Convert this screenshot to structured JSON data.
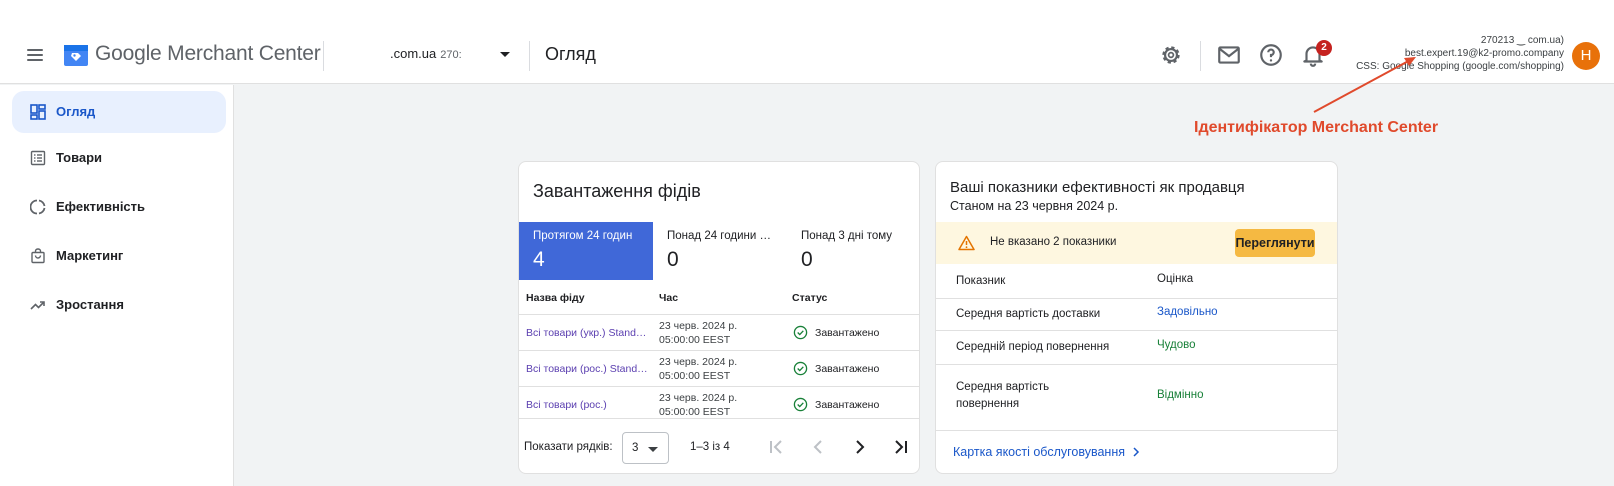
{
  "app": {
    "title": "Google Merchant Center",
    "account_name": ".com.ua",
    "account_id": "270:",
    "page_title": "Огляд",
    "notification_count": "2",
    "account_info": {
      "line1": "270213          ‿      com.ua)",
      "line2": "best.expert.19@k2-promo.company",
      "line3": "CSS: Google Shopping (google.com/shopping)"
    },
    "avatar_letter": "H"
  },
  "annotation": "Ідентифікатор Merchant Center",
  "sidebar": {
    "items": [
      {
        "label": "Огляд",
        "icon": "dashboard-icon",
        "active": true
      },
      {
        "label": "Товари",
        "icon": "list-alt-icon",
        "active": false
      },
      {
        "label": "Ефективність",
        "icon": "donut-icon",
        "active": false
      },
      {
        "label": "Маркетинг",
        "icon": "shopping-bag-icon",
        "active": false
      },
      {
        "label": "Зростання",
        "icon": "trending-up-icon",
        "active": false
      }
    ]
  },
  "feeds_card": {
    "title": "Завантаження фідів",
    "tabs": [
      {
        "label": "Протягом 24 годин",
        "value": "4",
        "selected": true
      },
      {
        "label": "Понад 24 години …",
        "value": "0",
        "selected": false
      },
      {
        "label": "Понад 3 дні тому",
        "value": "0",
        "selected": false
      }
    ],
    "columns": [
      "Назва фіду",
      "Час",
      "Статус"
    ],
    "rows": [
      {
        "name": "Всі товари (укр.) Stand…",
        "time_date": "23 черв. 2024 р.",
        "time_clock": "05:00:00 EEST",
        "status": "Завантажено"
      },
      {
        "name": "Всі товари (рос.) Stand…",
        "time_date": "23 черв. 2024 р.",
        "time_clock": "05:00:00 EEST",
        "status": "Завантажено"
      },
      {
        "name": "Всі товари (рос.)",
        "time_date": "23 черв. 2024 р.",
        "time_clock": "05:00:00 EEST",
        "status": "Завантажено"
      }
    ],
    "footer": {
      "rows_label": "Показати рядків:",
      "rows_value": "3",
      "range": "1–3 із 4"
    }
  },
  "perf_card": {
    "title": "Ваші показники ефективності як продавця",
    "subtitle": "Станом на 23 червня 2024 р.",
    "warning": "Не вказано 2 показники",
    "warning_button": "Переглянути",
    "columns": [
      "Показник",
      "Оцінка"
    ],
    "metrics": [
      {
        "name": "Середня вартість доставки",
        "rating": "Задовільно",
        "color": "#1a57c9"
      },
      {
        "name": "Середній період повернення",
        "rating": "Чудово",
        "color": "#188038"
      },
      {
        "name": "Середня вартість повернення",
        "rating": "Відмінно",
        "color": "#188038"
      }
    ],
    "link": "Картка якості обслуговування"
  },
  "colors": {
    "accent": "#4068d8",
    "warning_bg": "#fef7e0",
    "warning_button": "#f5b942",
    "annotation": "#e04a2c",
    "avatar": "#e8710a"
  }
}
